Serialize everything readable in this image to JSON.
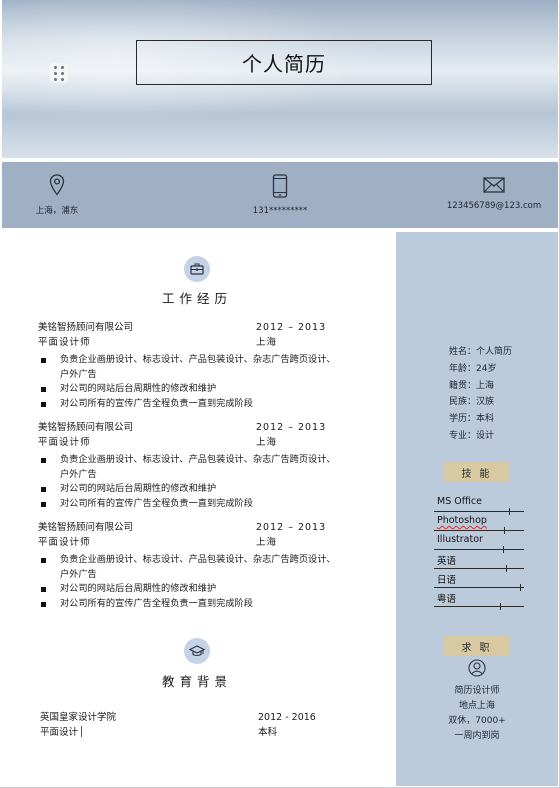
{
  "header": {
    "title": "个人简历"
  },
  "contact": {
    "location": "上海，浦东",
    "phone": "131*********",
    "email": "123456789@123.com",
    "icons": [
      "location-pin-icon",
      "mobile-phone-icon",
      "envelope-icon"
    ]
  },
  "experience": {
    "title": "工作经历",
    "icon": "briefcase-icon",
    "jobs": [
      {
        "company": "美铭智扬顾问有限公司",
        "period": "2012 – 2013",
        "role": "平面设计师",
        "city": "上海",
        "duties": [
          "负责企业画册设计、标志设计、产品包装设计、杂志广告跨页设计、户外广告",
          "对公司的网站后台周期性的修改和维护",
          "对公司所有的宣传广告全程负责一直到完成阶段"
        ]
      },
      {
        "company": "美铭智扬顾问有限公司",
        "period": "2012 – 2013",
        "role": "平面设计师",
        "city": "上海",
        "duties": [
          "负责企业画册设计、标志设计、产品包装设计、杂志广告跨页设计、户外广告",
          "对公司的网站后台周期性的修改和维护",
          "对公司所有的宣传广告全程负责一直到完成阶段"
        ]
      },
      {
        "company": "美铭智扬顾问有限公司",
        "period": "2012 – 2013",
        "role": "平面设计师",
        "city": "上海",
        "duties": [
          "负责企业画册设计、标志设计、产品包装设计、杂志广告跨页设计、户外广告",
          "对公司的网站后台周期性的修改和维护",
          "对公司所有的宣传广告全程负责一直到完成阶段"
        ]
      }
    ]
  },
  "education": {
    "title": "教育背景",
    "icon": "graduation-cap-icon",
    "school": "英国皇家设计学院",
    "years": "2012 - 2016",
    "major": "平面设计",
    "degree": "本科"
  },
  "profile": {
    "lines": [
      "姓名：个人简历",
      "年龄：24岁",
      "籍贯：上海",
      "民族：汉族",
      "学历：本科",
      "专业：设计"
    ]
  },
  "skills": {
    "title": "技能",
    "items": [
      {
        "name": "MS Office",
        "level": 0.85
      },
      {
        "name": "Photoshop",
        "level": 0.8
      },
      {
        "name": "Illustrator",
        "level": 0.78
      },
      {
        "name": "英语",
        "level": 0.82
      },
      {
        "name": "日语",
        "level": 0.98
      },
      {
        "name": "粤语",
        "level": 0.75
      }
    ]
  },
  "job_intent": {
    "title": "求职",
    "icon": "user-icon",
    "lines": [
      "简历设计师",
      "地点上海",
      "双休，7000+",
      "一周内到岗"
    ]
  },
  "colors": {
    "contact_bar": "#9fb0c5",
    "sidebar": "#bccbdc",
    "tag": "#d7c9a1",
    "icon_circle": "#c5d3e6"
  }
}
